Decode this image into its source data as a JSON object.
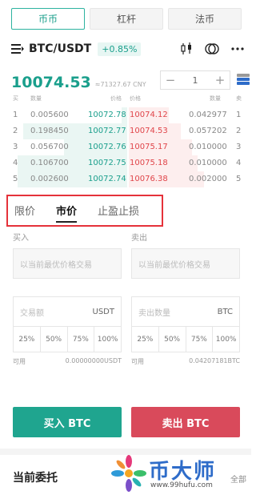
{
  "top_tabs": [
    {
      "label": "币币",
      "active": true
    },
    {
      "label": "杠杆",
      "active": false
    },
    {
      "label": "法币",
      "active": false
    }
  ],
  "pair": {
    "name": "BTC/USDT",
    "change": "+0.85%",
    "icons": [
      "menu-icon",
      "candlestick-icon",
      "compare-icon",
      "more-icon"
    ]
  },
  "price": {
    "last": "10074.53",
    "cny": "≈71327.67 CNY"
  },
  "stepper": {
    "minus": "−",
    "value": "1",
    "plus": "+"
  },
  "book_head": {
    "buy": "买",
    "qty": "数量",
    "price_l": "价格",
    "price_r": "价格",
    "qty_r": "数量",
    "sell": "卖"
  },
  "order_book": [
    {
      "idx": "1",
      "bid_qty": "0.005600",
      "bid_price": "10072.78",
      "ask_price": "10074.12",
      "ask_qty": "0.042977",
      "ask_idx": "1",
      "bid_depth": 0.05,
      "ask_depth": 0.35
    },
    {
      "idx": "2",
      "bid_qty": "0.198450",
      "bid_price": "10072.77",
      "ask_price": "10074.53",
      "ask_qty": "0.057202",
      "ask_idx": "2",
      "bid_depth": 0.9,
      "ask_depth": 0.45
    },
    {
      "idx": "3",
      "bid_qty": "0.056700",
      "bid_price": "10072.76",
      "ask_price": "10075.17",
      "ask_qty": "0.010000",
      "ask_idx": "3",
      "bid_depth": 0.55,
      "ask_depth": 0.55
    },
    {
      "idx": "4",
      "bid_qty": "0.106700",
      "bid_price": "10072.75",
      "ask_price": "10075.18",
      "ask_qty": "0.010000",
      "ask_idx": "4",
      "bid_depth": 0.95,
      "ask_depth": 0.6
    },
    {
      "idx": "5",
      "bid_qty": "0.002600",
      "bid_price": "10072.74",
      "ask_price": "10076.38",
      "ask_qty": "0.002000",
      "ask_idx": "5",
      "bid_depth": 0.95,
      "ask_depth": 0.65
    }
  ],
  "order_types": [
    {
      "label": "限价",
      "active": false
    },
    {
      "label": "市价",
      "active": true
    },
    {
      "label": "止盈止损",
      "active": false
    }
  ],
  "buy": {
    "label": "买入",
    "price_placeholder": "以当前最优价格交易",
    "amount_placeholder": "交易额",
    "amount_unit": "USDT",
    "percents": [
      "25%",
      "50%",
      "75%",
      "100%"
    ],
    "avail_label": "可用",
    "avail_value": "0.00000000USDT",
    "button": "买入 BTC"
  },
  "sell": {
    "label": "卖出",
    "price_placeholder": "以当前最优价格交易",
    "amount_placeholder": "卖出数量",
    "amount_unit": "BTC",
    "percents": [
      "25%",
      "50%",
      "75%",
      "100%"
    ],
    "avail_label": "可用",
    "avail_value": "0.04207181BTC",
    "button": "卖出 BTC"
  },
  "orders": {
    "title": "当前委托",
    "all": "全部"
  },
  "watermark": {
    "text": "币大师",
    "url": "www.99hufu.com"
  },
  "colors": {
    "green": "#1a9f8c",
    "red": "#e0454a",
    "buy_button": "#1fa58f",
    "sell_button": "#d94a5b",
    "highlight_box": "#e5323a"
  }
}
